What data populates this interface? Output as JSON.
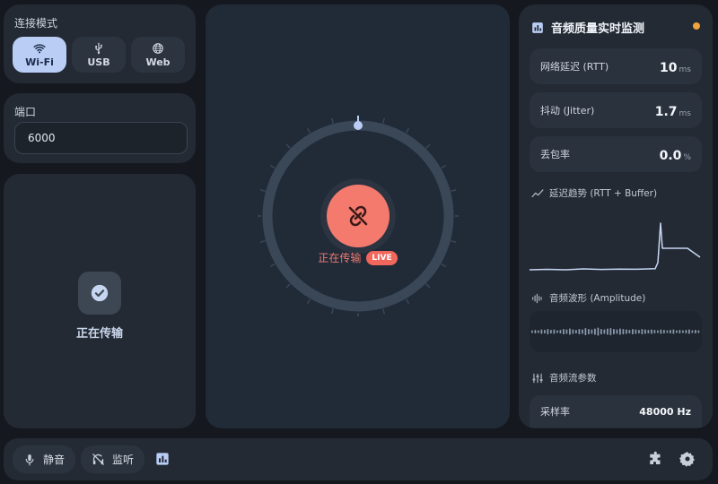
{
  "connection": {
    "title": "连接模式",
    "modes": [
      {
        "label": "Wi-Fi",
        "icon": "wifi-icon",
        "active": true
      },
      {
        "label": "USB",
        "icon": "usb-icon",
        "active": false
      },
      {
        "label": "Web",
        "icon": "globe-icon",
        "active": false
      }
    ]
  },
  "port": {
    "title": "端口",
    "value": "6000"
  },
  "status": {
    "label": "正在传输",
    "icon": "check-circle-icon"
  },
  "center": {
    "status_text": "正在传输",
    "badge": "LIVE",
    "button_icon": "link-off-icon"
  },
  "monitor": {
    "title": "音频质量实时监测",
    "indicator_color": "#f0a33a",
    "metrics": [
      {
        "label": "网络延迟 (RTT)",
        "value": "10",
        "unit": "ms"
      },
      {
        "label": "抖动 (Jitter)",
        "value": "1.7",
        "unit": "ms"
      },
      {
        "label": "丢包率",
        "value": "0.0",
        "unit": "%"
      }
    ],
    "trend_title": "延迟趋势 (RTT + Buffer)",
    "wave_title": "音频波形 (Amplitude)",
    "params_title": "音频流参数",
    "params": [
      {
        "label": "采样率",
        "value": "48000 Hz"
      }
    ]
  },
  "bottom": {
    "mute_label": "静音",
    "monitor_label": "监听"
  },
  "colors": {
    "accent": "#b9cdf5",
    "live": "#f1675c",
    "record_button": "#f57a6e"
  }
}
